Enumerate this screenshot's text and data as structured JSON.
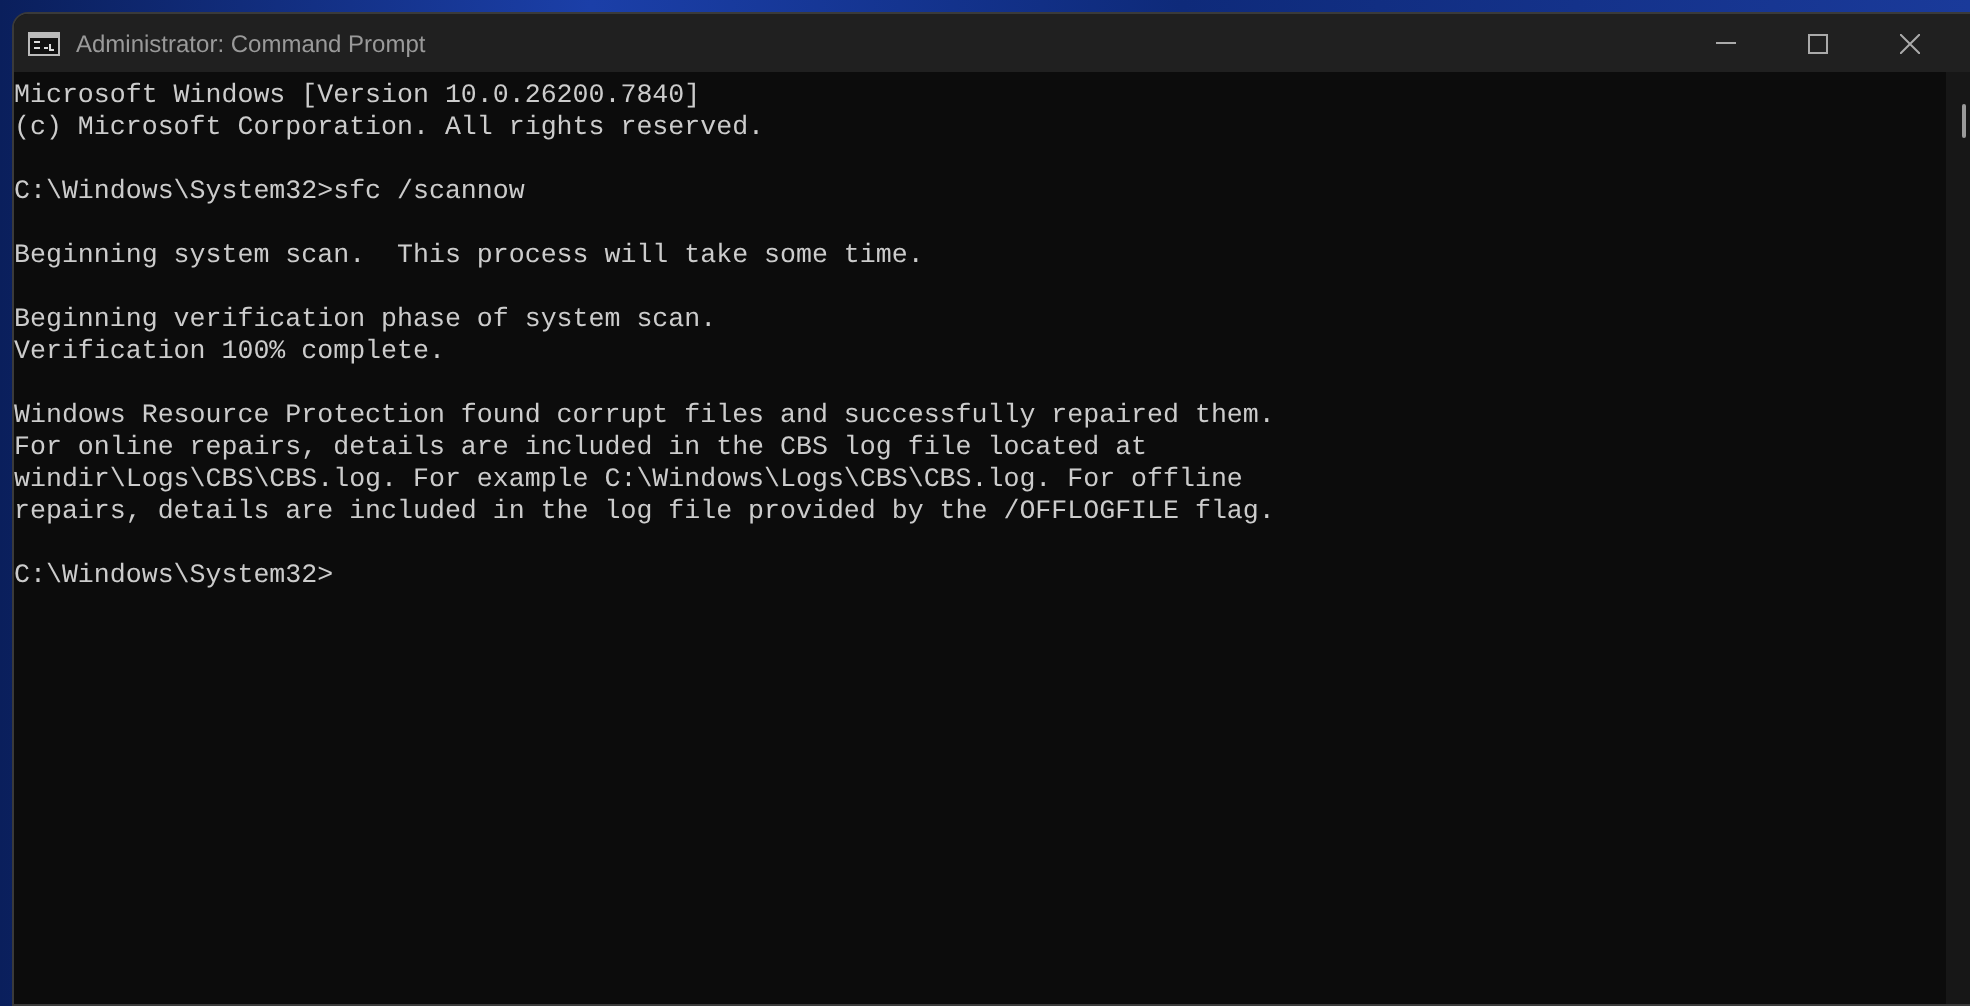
{
  "window": {
    "title": "Administrator: Command Prompt"
  },
  "console": {
    "blocks": [
      {
        "lines": [
          "Microsoft Windows [Version 10.0.26200.7840]",
          "(c) Microsoft Corporation. All rights reserved."
        ]
      },
      {
        "lines": [
          "C:\\Windows\\System32>sfc /scannow"
        ]
      },
      {
        "lines": [
          "Beginning system scan.  This process will take some time."
        ]
      },
      {
        "lines": [
          "Beginning verification phase of system scan.",
          "Verification 100% complete."
        ]
      },
      {
        "lines": [
          "Windows Resource Protection found corrupt files and successfully repaired them.",
          "For online repairs, details are included in the CBS log file located at",
          "windir\\Logs\\CBS\\CBS.log. For example C:\\Windows\\Logs\\CBS\\CBS.log. For offline",
          "repairs, details are included in the log file provided by the /OFFLOGFILE flag."
        ]
      },
      {
        "lines": [
          "C:\\Windows\\System32>"
        ]
      }
    ]
  }
}
